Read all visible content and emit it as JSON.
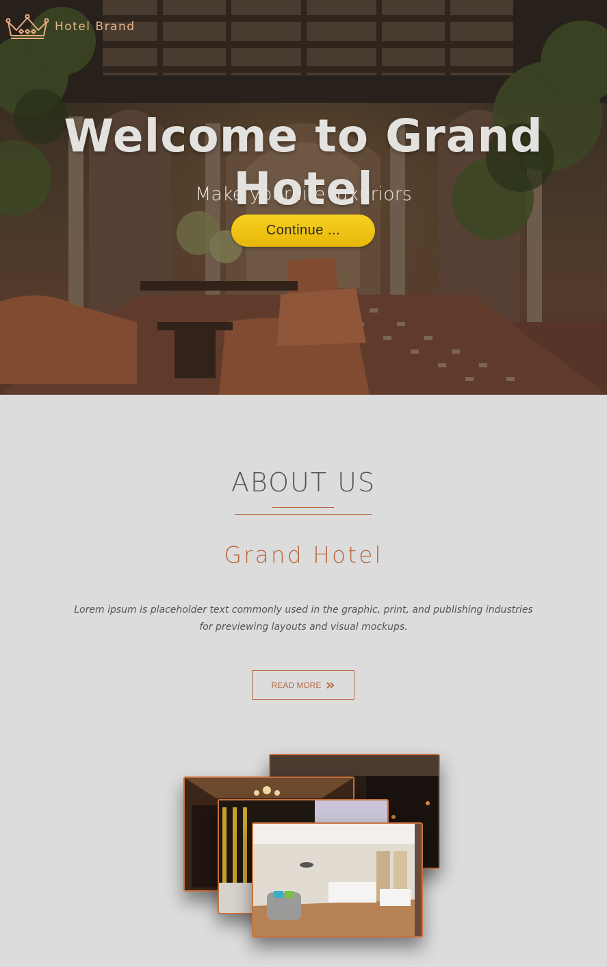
{
  "brand": {
    "name": "Hotel Brand",
    "logo_icon": "crown-icon"
  },
  "hero": {
    "title": "Welcome to Grand Hotel",
    "subtitle": "Make your life luxuriors",
    "cta_label": "Continue ..."
  },
  "about": {
    "heading": "ABOUT US",
    "subheading": "Grand Hotel",
    "body": "Lorem ipsum is placeholder text commonly used in the graphic, print, and publishing industries for previewing layouts and visual mockups.",
    "read_more_label": "READ MORE",
    "read_more_icon": "double-chevron-right-icon"
  },
  "colors": {
    "accent": "#b9683f",
    "cta": "#f2c413",
    "background": "#dcdcdc"
  }
}
